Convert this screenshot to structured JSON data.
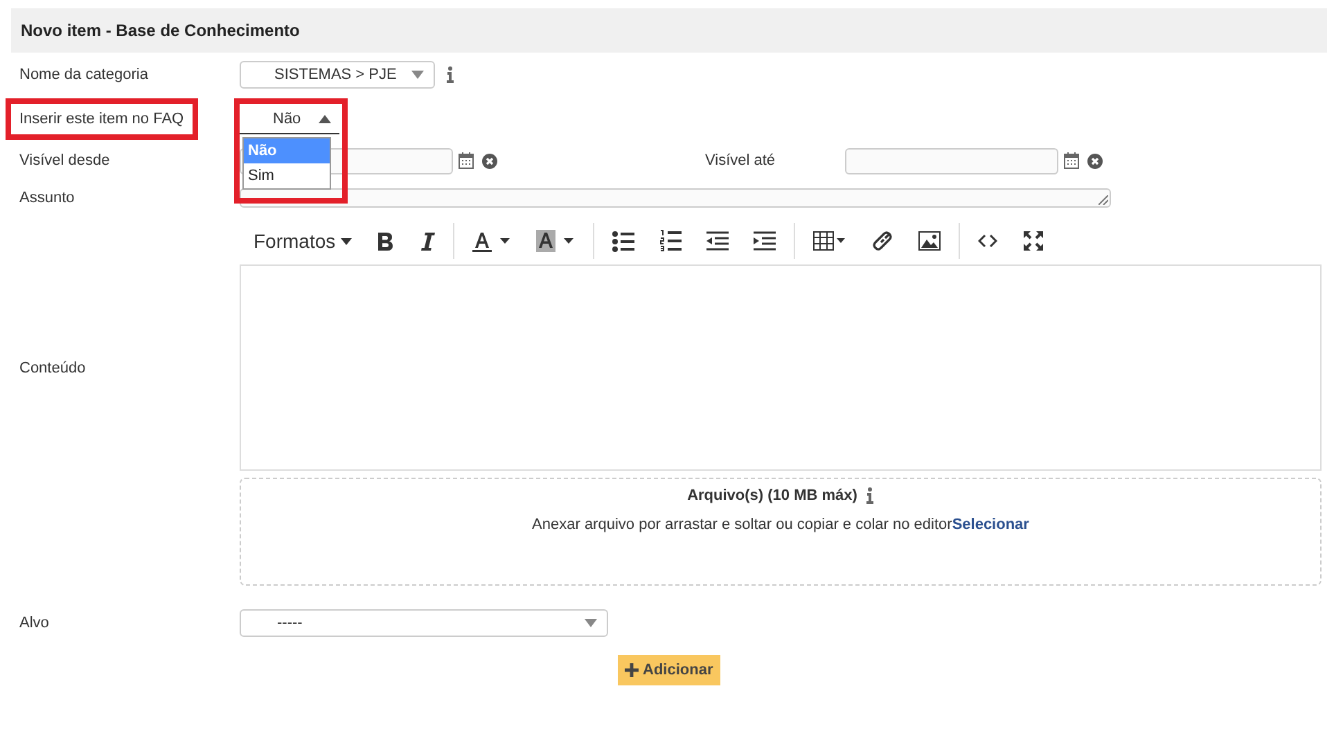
{
  "header": {
    "title": "Novo item - Base de Conhecimento"
  },
  "category": {
    "label": "Nome da categoria",
    "value": "SISTEMAS > PJE"
  },
  "faq": {
    "label": "Inserir este item no FAQ",
    "value": "Não",
    "expanded": true,
    "highlighted": true,
    "options": [
      {
        "label": "Não",
        "selected": true
      },
      {
        "label": "Sim",
        "selected": false
      }
    ]
  },
  "visible_from": {
    "label": "Visível desde"
  },
  "visible_until": {
    "label": "Visível até"
  },
  "subject": {
    "label": "Assunto"
  },
  "content": {
    "label": "Conteúdo",
    "toolbar": [
      [
        {
          "kind": "formats",
          "label": "Formatos"
        },
        {
          "kind": "bold"
        },
        {
          "kind": "italic"
        }
      ],
      [
        {
          "kind": "forecolor"
        },
        {
          "kind": "backcolor"
        }
      ],
      [
        {
          "kind": "bullets"
        },
        {
          "kind": "numbers"
        },
        {
          "kind": "outdent"
        },
        {
          "kind": "indent"
        }
      ],
      [
        {
          "kind": "table"
        },
        {
          "kind": "link"
        },
        {
          "kind": "image"
        }
      ],
      [
        {
          "kind": "code"
        },
        {
          "kind": "fullscreen"
        }
      ]
    ]
  },
  "attachments": {
    "title": "Arquivo(s) (10 MB máx)",
    "hint": "Anexar arquivo por arrastar e soltar ou copiar e colar no editor",
    "link": "Selecionar"
  },
  "target": {
    "label": "Alvo",
    "value": "-----"
  },
  "add_button": {
    "label": "Adicionar"
  }
}
